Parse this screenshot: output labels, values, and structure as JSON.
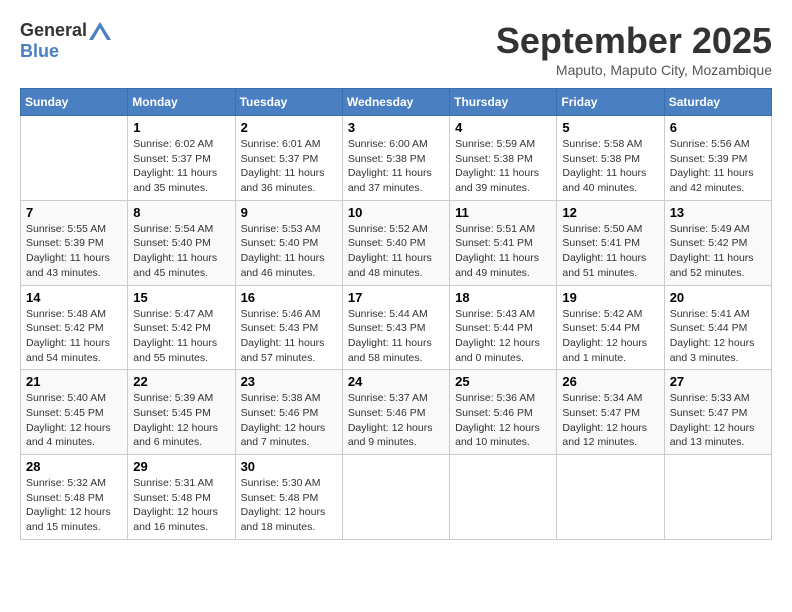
{
  "header": {
    "logo_general": "General",
    "logo_blue": "Blue",
    "month_title": "September 2025",
    "subtitle": "Maputo, Maputo City, Mozambique"
  },
  "days_of_week": [
    "Sunday",
    "Monday",
    "Tuesday",
    "Wednesday",
    "Thursday",
    "Friday",
    "Saturday"
  ],
  "weeks": [
    [
      {
        "day": "",
        "sunrise": "",
        "sunset": "",
        "daylight": ""
      },
      {
        "day": "1",
        "sunrise": "Sunrise: 6:02 AM",
        "sunset": "Sunset: 5:37 PM",
        "daylight": "Daylight: 11 hours and 35 minutes."
      },
      {
        "day": "2",
        "sunrise": "Sunrise: 6:01 AM",
        "sunset": "Sunset: 5:37 PM",
        "daylight": "Daylight: 11 hours and 36 minutes."
      },
      {
        "day": "3",
        "sunrise": "Sunrise: 6:00 AM",
        "sunset": "Sunset: 5:38 PM",
        "daylight": "Daylight: 11 hours and 37 minutes."
      },
      {
        "day": "4",
        "sunrise": "Sunrise: 5:59 AM",
        "sunset": "Sunset: 5:38 PM",
        "daylight": "Daylight: 11 hours and 39 minutes."
      },
      {
        "day": "5",
        "sunrise": "Sunrise: 5:58 AM",
        "sunset": "Sunset: 5:38 PM",
        "daylight": "Daylight: 11 hours and 40 minutes."
      },
      {
        "day": "6",
        "sunrise": "Sunrise: 5:56 AM",
        "sunset": "Sunset: 5:39 PM",
        "daylight": "Daylight: 11 hours and 42 minutes."
      }
    ],
    [
      {
        "day": "7",
        "sunrise": "Sunrise: 5:55 AM",
        "sunset": "Sunset: 5:39 PM",
        "daylight": "Daylight: 11 hours and 43 minutes."
      },
      {
        "day": "8",
        "sunrise": "Sunrise: 5:54 AM",
        "sunset": "Sunset: 5:40 PM",
        "daylight": "Daylight: 11 hours and 45 minutes."
      },
      {
        "day": "9",
        "sunrise": "Sunrise: 5:53 AM",
        "sunset": "Sunset: 5:40 PM",
        "daylight": "Daylight: 11 hours and 46 minutes."
      },
      {
        "day": "10",
        "sunrise": "Sunrise: 5:52 AM",
        "sunset": "Sunset: 5:40 PM",
        "daylight": "Daylight: 11 hours and 48 minutes."
      },
      {
        "day": "11",
        "sunrise": "Sunrise: 5:51 AM",
        "sunset": "Sunset: 5:41 PM",
        "daylight": "Daylight: 11 hours and 49 minutes."
      },
      {
        "day": "12",
        "sunrise": "Sunrise: 5:50 AM",
        "sunset": "Sunset: 5:41 PM",
        "daylight": "Daylight: 11 hours and 51 minutes."
      },
      {
        "day": "13",
        "sunrise": "Sunrise: 5:49 AM",
        "sunset": "Sunset: 5:42 PM",
        "daylight": "Daylight: 11 hours and 52 minutes."
      }
    ],
    [
      {
        "day": "14",
        "sunrise": "Sunrise: 5:48 AM",
        "sunset": "Sunset: 5:42 PM",
        "daylight": "Daylight: 11 hours and 54 minutes."
      },
      {
        "day": "15",
        "sunrise": "Sunrise: 5:47 AM",
        "sunset": "Sunset: 5:42 PM",
        "daylight": "Daylight: 11 hours and 55 minutes."
      },
      {
        "day": "16",
        "sunrise": "Sunrise: 5:46 AM",
        "sunset": "Sunset: 5:43 PM",
        "daylight": "Daylight: 11 hours and 57 minutes."
      },
      {
        "day": "17",
        "sunrise": "Sunrise: 5:44 AM",
        "sunset": "Sunset: 5:43 PM",
        "daylight": "Daylight: 11 hours and 58 minutes."
      },
      {
        "day": "18",
        "sunrise": "Sunrise: 5:43 AM",
        "sunset": "Sunset: 5:44 PM",
        "daylight": "Daylight: 12 hours and 0 minutes."
      },
      {
        "day": "19",
        "sunrise": "Sunrise: 5:42 AM",
        "sunset": "Sunset: 5:44 PM",
        "daylight": "Daylight: 12 hours and 1 minute."
      },
      {
        "day": "20",
        "sunrise": "Sunrise: 5:41 AM",
        "sunset": "Sunset: 5:44 PM",
        "daylight": "Daylight: 12 hours and 3 minutes."
      }
    ],
    [
      {
        "day": "21",
        "sunrise": "Sunrise: 5:40 AM",
        "sunset": "Sunset: 5:45 PM",
        "daylight": "Daylight: 12 hours and 4 minutes."
      },
      {
        "day": "22",
        "sunrise": "Sunrise: 5:39 AM",
        "sunset": "Sunset: 5:45 PM",
        "daylight": "Daylight: 12 hours and 6 minutes."
      },
      {
        "day": "23",
        "sunrise": "Sunrise: 5:38 AM",
        "sunset": "Sunset: 5:46 PM",
        "daylight": "Daylight: 12 hours and 7 minutes."
      },
      {
        "day": "24",
        "sunrise": "Sunrise: 5:37 AM",
        "sunset": "Sunset: 5:46 PM",
        "daylight": "Daylight: 12 hours and 9 minutes."
      },
      {
        "day": "25",
        "sunrise": "Sunrise: 5:36 AM",
        "sunset": "Sunset: 5:46 PM",
        "daylight": "Daylight: 12 hours and 10 minutes."
      },
      {
        "day": "26",
        "sunrise": "Sunrise: 5:34 AM",
        "sunset": "Sunset: 5:47 PM",
        "daylight": "Daylight: 12 hours and 12 minutes."
      },
      {
        "day": "27",
        "sunrise": "Sunrise: 5:33 AM",
        "sunset": "Sunset: 5:47 PM",
        "daylight": "Daylight: 12 hours and 13 minutes."
      }
    ],
    [
      {
        "day": "28",
        "sunrise": "Sunrise: 5:32 AM",
        "sunset": "Sunset: 5:48 PM",
        "daylight": "Daylight: 12 hours and 15 minutes."
      },
      {
        "day": "29",
        "sunrise": "Sunrise: 5:31 AM",
        "sunset": "Sunset: 5:48 PM",
        "daylight": "Daylight: 12 hours and 16 minutes."
      },
      {
        "day": "30",
        "sunrise": "Sunrise: 5:30 AM",
        "sunset": "Sunset: 5:48 PM",
        "daylight": "Daylight: 12 hours and 18 minutes."
      },
      {
        "day": "",
        "sunrise": "",
        "sunset": "",
        "daylight": ""
      },
      {
        "day": "",
        "sunrise": "",
        "sunset": "",
        "daylight": ""
      },
      {
        "day": "",
        "sunrise": "",
        "sunset": "",
        "daylight": ""
      },
      {
        "day": "",
        "sunrise": "",
        "sunset": "",
        "daylight": ""
      }
    ]
  ]
}
